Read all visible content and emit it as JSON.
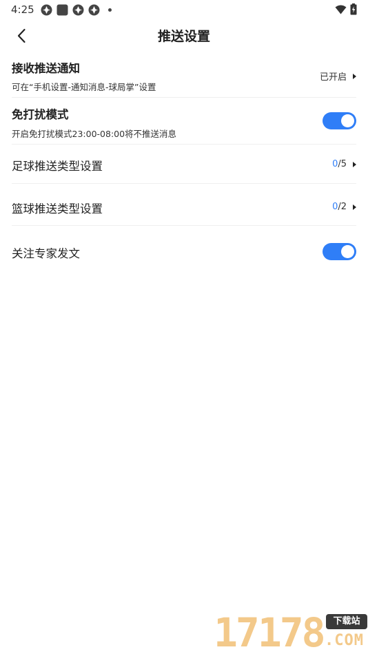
{
  "status_bar": {
    "time": "4:25",
    "left_icons": [
      "app-icon-1",
      "app-icon-2",
      "app-icon-3",
      "app-icon-4",
      "notification-dot"
    ],
    "right_icons": [
      "wifi-icon",
      "battery-charging-icon"
    ]
  },
  "nav": {
    "title": "推送设置",
    "back_icon": "chevron-left-icon"
  },
  "settings": {
    "receive_push": {
      "title": "接收推送通知",
      "subtitle": "可在“手机设置-通知消息-球局掌”设置",
      "status": "已开启"
    },
    "dnd": {
      "title": "免打扰模式",
      "subtitle": "开启免打扰模式23:00-08:00将不推送消息",
      "enabled": true
    },
    "football": {
      "title": "足球推送类型设置",
      "selected": "0",
      "total": "/5"
    },
    "basketball": {
      "title": "篮球推送类型设置",
      "selected": "0",
      "total": "/2"
    },
    "expert": {
      "title": "关注专家发文",
      "enabled": true
    }
  },
  "watermark": {
    "number": "17178",
    "badge": "下载站",
    "domain": ".COM"
  },
  "colors": {
    "accent": "#2f7ef7",
    "divider": "#efefef",
    "watermark": "#f3c98a"
  }
}
